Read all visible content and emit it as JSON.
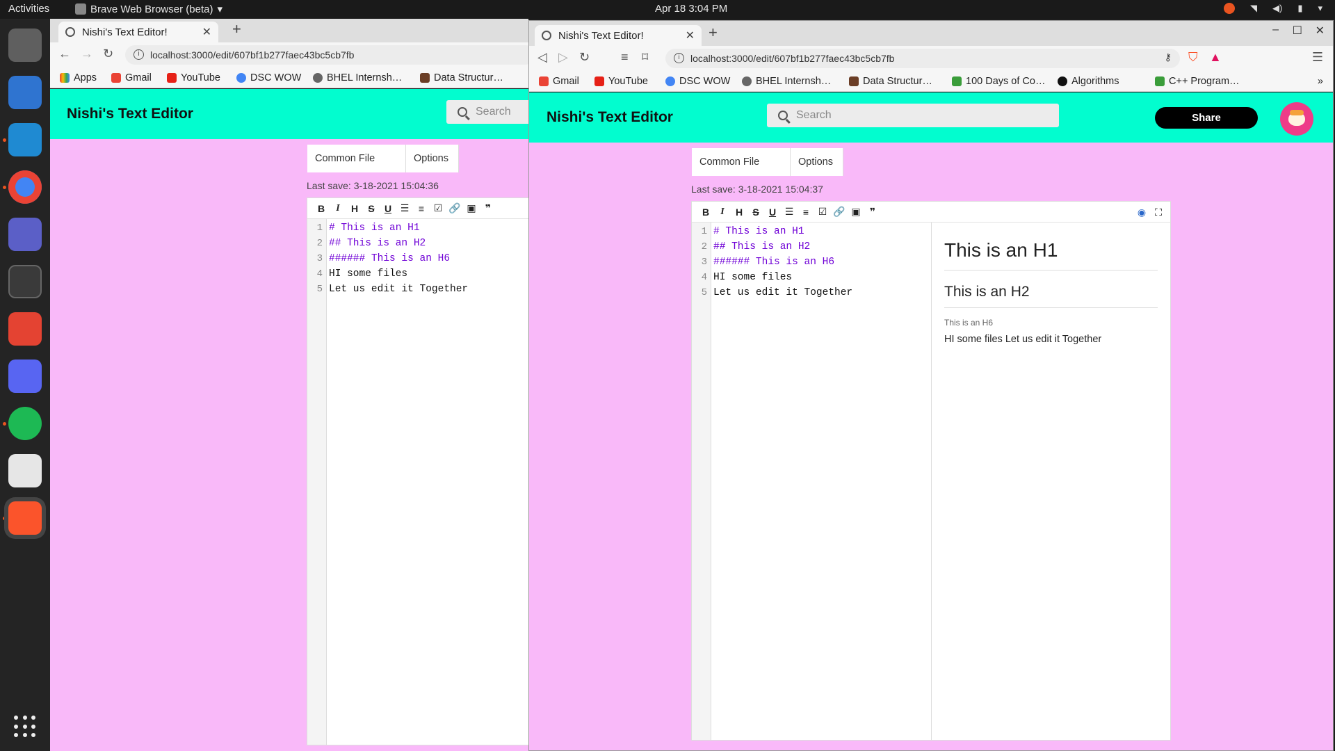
{
  "topbar": {
    "activities": "Activities",
    "app_menu": "Brave Web Browser (beta)",
    "clock": "Apr 18  3:04 PM"
  },
  "dock": {
    "items": [
      "files-icon",
      "docs-icon",
      "vscode-icon",
      "chrome-icon",
      "teams-icon",
      "terminal-icon",
      "todoist-icon",
      "discord-icon",
      "spotify-icon",
      "reader-icon",
      "brave-icon"
    ]
  },
  "colors": {
    "header_accent": "#02fdcf",
    "page_bg": "#f9b9f9",
    "markdown_heading": "#6f00d6",
    "share_button": "#000000"
  },
  "back_window": {
    "tab_title": "Nishi's Text Editor!",
    "url": "localhost:3000/edit/607bf1b277faec43bc5cb7fb",
    "bookmarks": [
      "Apps",
      "Gmail",
      "YouTube",
      "DSC WOW",
      "BHEL Internsh…",
      "Data Structur…"
    ],
    "app_title": "Nishi's Text Editor",
    "search_placeholder": "Search",
    "menu": [
      "Common File",
      "Options"
    ],
    "last_save": "Last save: 3-18-2021 15:04:36",
    "lines": [
      "# This is an H1",
      "## This is an H2",
      "###### This is an H6",
      "HI some files",
      "Let us edit it Together"
    ],
    "line_numbers": [
      "1",
      "2",
      "3",
      "4",
      "5"
    ]
  },
  "front_window": {
    "tab_title": "Nishi's Text Editor!",
    "url": "localhost:3000/edit/607bf1b277faec43bc5cb7fb",
    "bookmarks": [
      "Gmail",
      "YouTube",
      "DSC WOW",
      "BHEL Internsh…",
      "Data Structur…",
      "100 Days of Co…",
      "Algorithms",
      "C++ Program…"
    ],
    "app_title": "Nishi's Text Editor",
    "search_placeholder": "Search",
    "share_label": "Share",
    "menu": [
      "Common File",
      "Options"
    ],
    "last_save": "Last save: 3-18-2021 15:04:37",
    "lines": [
      "# This is an H1",
      "## This is an H2",
      "###### This is an H6",
      "HI some files",
      "Let us edit it Together"
    ],
    "line_numbers": [
      "1",
      "2",
      "3",
      "4",
      "5"
    ],
    "preview": {
      "h1": "This is an H1",
      "h2": "This is an H2",
      "h6": "This is an H6",
      "paragraph": "HI some files Let us edit it Together"
    }
  },
  "toolbar_buttons": [
    "B",
    "I",
    "H",
    "S",
    "U",
    "☰",
    "≡",
    "☑",
    "🔗",
    "▣",
    "❞"
  ]
}
